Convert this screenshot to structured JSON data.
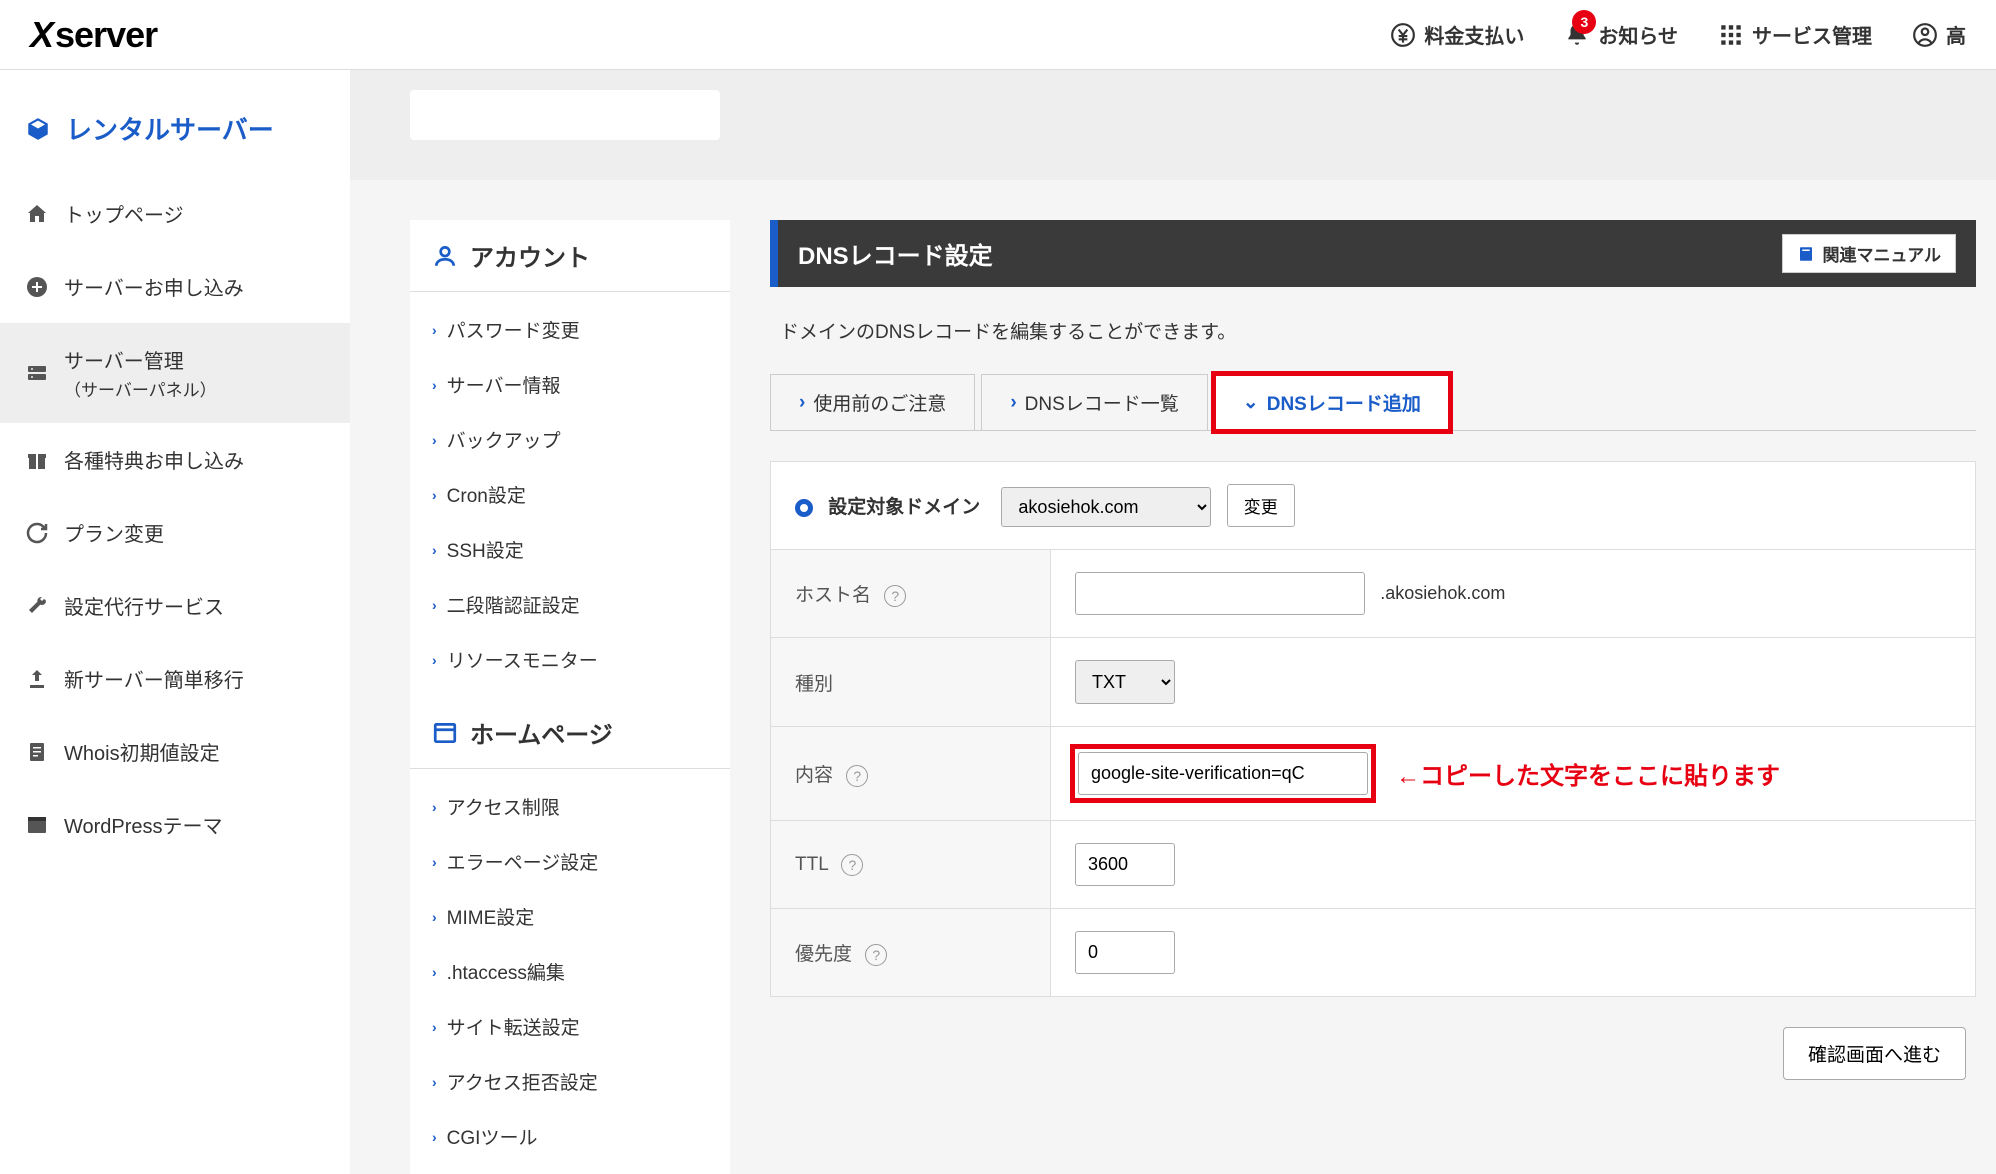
{
  "top_bar": {
    "logo": "server",
    "items": {
      "payment": "料金支払い",
      "notice": "お知らせ",
      "notice_badge": "3",
      "service_mgmt": "サービス管理",
      "user": "高"
    }
  },
  "left_sidebar": {
    "title": "レンタルサーバー",
    "items": [
      {
        "label": "トップページ"
      },
      {
        "label": "サーバーお申し込み"
      },
      {
        "label": "サーバー管理",
        "sub": "（サーバーパネル）"
      },
      {
        "label": "各種特典お申し込み"
      },
      {
        "label": "プラン変更"
      },
      {
        "label": "設定代行サービス"
      },
      {
        "label": "新サーバー簡単移行"
      },
      {
        "label": "Whois初期値設定"
      },
      {
        "label": "WordPressテーマ"
      }
    ]
  },
  "mid_panel": {
    "sections": [
      {
        "title": "アカウント",
        "items": [
          "パスワード変更",
          "サーバー情報",
          "バックアップ",
          "Cron設定",
          "SSH設定",
          "二段階認証設定",
          "リソースモニター"
        ]
      },
      {
        "title": "ホームページ",
        "items": [
          "アクセス制限",
          "エラーページ設定",
          "MIME設定",
          ".htaccess編集",
          "サイト転送設定",
          "アクセス拒否設定",
          "CGIツール"
        ]
      }
    ]
  },
  "main": {
    "title": "DNSレコード設定",
    "manual_btn": "関連マニュアル",
    "description": "ドメインのDNSレコードを編集することができます。",
    "tabs": [
      "使用前のご注意",
      "DNSレコード一覧",
      "DNSレコード追加"
    ],
    "form": {
      "target_label": "設定対象ドメイン",
      "domain_value": "akosiehok.com",
      "change_btn": "変更",
      "hostname_label": "ホスト名",
      "hostname_value": "",
      "hostname_suffix": ".akosiehok.com",
      "type_label": "種別",
      "type_value": "TXT",
      "content_label": "内容",
      "content_value": "google-site-verification=qC",
      "content_annotation": "←コピーした文字をここに貼ります",
      "ttl_label": "TTL",
      "ttl_value": "3600",
      "priority_label": "優先度",
      "priority_value": "0"
    },
    "confirm_btn": "確認画面へ進む"
  }
}
